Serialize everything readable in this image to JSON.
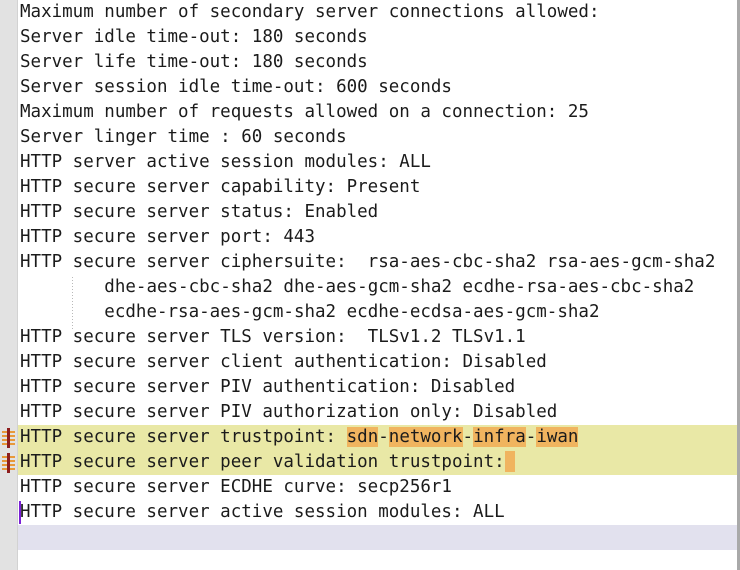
{
  "editor": {
    "font": {
      "char_width": 12.1,
      "line_height": 25
    },
    "colors": {
      "background": "#ffffff",
      "gutter": "#e2e2e2",
      "text": "#1b1b1b",
      "search_line_highlight": "#e9e8a6",
      "search_token_highlight": "#f0b45f",
      "current_line_highlight": "#e2e1ee",
      "caret": "#7a1fd6",
      "change_marker_orange": "#e8993a",
      "change_marker_red": "#8d1d1d",
      "indent_guide": "#b9b9b9"
    },
    "gutter_markers": [
      {
        "line_index": 16,
        "icon": "change-marker-icon"
      },
      {
        "line_index": 17,
        "icon": "change-marker-icon"
      }
    ],
    "caret": {
      "line_index": 20,
      "column": 0
    },
    "lines": [
      {
        "id": 0,
        "text": "Maximum number of secondary server connections allowed:",
        "indent": false,
        "state": "normal"
      },
      {
        "id": 1,
        "text": "Server idle time-out: 180 seconds",
        "indent": false,
        "state": "normal"
      },
      {
        "id": 2,
        "text": "Server life time-out: 180 seconds",
        "indent": false,
        "state": "normal"
      },
      {
        "id": 3,
        "text": "Server session idle time-out: 600 seconds",
        "indent": false,
        "state": "normal"
      },
      {
        "id": 4,
        "text": "Maximum number of requests allowed on a connection: 25",
        "indent": false,
        "state": "normal"
      },
      {
        "id": 5,
        "text": "Server linger time : 60 seconds",
        "indent": false,
        "state": "normal"
      },
      {
        "id": 6,
        "text": "HTTP server active session modules: ALL",
        "indent": false,
        "state": "normal"
      },
      {
        "id": 7,
        "text": "HTTP secure server capability: Present",
        "indent": false,
        "state": "normal"
      },
      {
        "id": 8,
        "text": "HTTP secure server status: Enabled",
        "indent": false,
        "state": "normal"
      },
      {
        "id": 9,
        "text": "HTTP secure server port: 443",
        "indent": false,
        "state": "normal"
      },
      {
        "id": 10,
        "text": "HTTP secure server ciphersuite:  rsa-aes-cbc-sha2 rsa-aes-gcm-sha2",
        "indent": false,
        "state": "normal"
      },
      {
        "id": 11,
        "text": "dhe-aes-cbc-sha2 dhe-aes-gcm-sha2 ecdhe-rsa-aes-cbc-sha2",
        "indent": true,
        "state": "normal"
      },
      {
        "id": 12,
        "text": "ecdhe-rsa-aes-gcm-sha2 ecdhe-ecdsa-aes-gcm-sha2",
        "indent": true,
        "state": "normal"
      },
      {
        "id": 13,
        "text": "HTTP secure server TLS version:  TLSv1.2 TLSv1.1",
        "indent": false,
        "state": "normal"
      },
      {
        "id": 14,
        "text": "HTTP secure server client authentication: Disabled",
        "indent": false,
        "state": "normal"
      },
      {
        "id": 15,
        "text": "HTTP secure server PIV authentication: Disabled",
        "indent": false,
        "state": "normal"
      },
      {
        "id": 16,
        "text": "HTTP secure server PIV authorization only: Disabled",
        "indent": false,
        "state": "normal"
      },
      {
        "id": 17,
        "text": "HTTP secure server trustpoint: sdn-network-infra-iwan",
        "indent": false,
        "state": "search-hit",
        "segments": [
          {
            "t": "HTTP secure server trustpoint: ",
            "hit": false
          },
          {
            "t": "sdn",
            "hit": true
          },
          {
            "t": "-",
            "hit": false
          },
          {
            "t": "network",
            "hit": true
          },
          {
            "t": "-",
            "hit": false
          },
          {
            "t": "infra",
            "hit": true
          },
          {
            "t": "-",
            "hit": false
          },
          {
            "t": "iwan",
            "hit": true
          }
        ]
      },
      {
        "id": 18,
        "text": "HTTP secure server peer validation trustpoint: ",
        "indent": false,
        "state": "search-hit",
        "segments": [
          {
            "t": "HTTP secure server peer validation trustpoint:",
            "hit": false
          },
          {
            "t": "",
            "hit": true,
            "empty": true
          }
        ]
      },
      {
        "id": 19,
        "text": "HTTP secure server ECDHE curve: secp256r1",
        "indent": false,
        "state": "normal"
      },
      {
        "id": 20,
        "text": "HTTP secure server active session modules: ALL",
        "indent": false,
        "state": "normal"
      },
      {
        "id": 21,
        "text": "",
        "indent": false,
        "state": "current-line"
      },
      {
        "id": 22,
        "text": "",
        "indent": false,
        "state": "normal"
      }
    ]
  }
}
